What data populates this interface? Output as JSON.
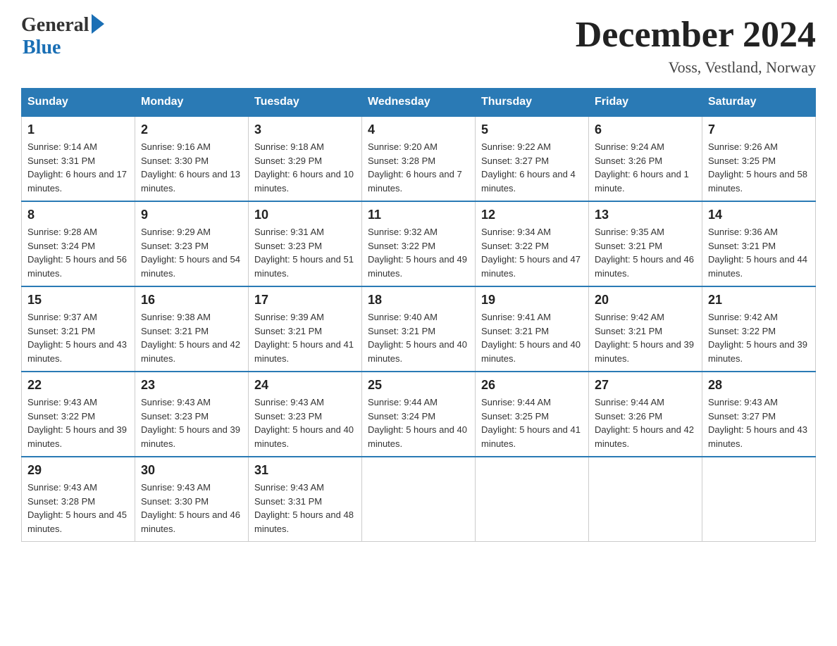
{
  "logo": {
    "general": "General",
    "blue": "Blue"
  },
  "header": {
    "title": "December 2024",
    "location": "Voss, Vestland, Norway"
  },
  "days_of_week": [
    "Sunday",
    "Monday",
    "Tuesday",
    "Wednesday",
    "Thursday",
    "Friday",
    "Saturday"
  ],
  "weeks": [
    [
      {
        "day": "1",
        "sunrise": "9:14 AM",
        "sunset": "3:31 PM",
        "daylight": "6 hours and 17 minutes."
      },
      {
        "day": "2",
        "sunrise": "9:16 AM",
        "sunset": "3:30 PM",
        "daylight": "6 hours and 13 minutes."
      },
      {
        "day": "3",
        "sunrise": "9:18 AM",
        "sunset": "3:29 PM",
        "daylight": "6 hours and 10 minutes."
      },
      {
        "day": "4",
        "sunrise": "9:20 AM",
        "sunset": "3:28 PM",
        "daylight": "6 hours and 7 minutes."
      },
      {
        "day": "5",
        "sunrise": "9:22 AM",
        "sunset": "3:27 PM",
        "daylight": "6 hours and 4 minutes."
      },
      {
        "day": "6",
        "sunrise": "9:24 AM",
        "sunset": "3:26 PM",
        "daylight": "6 hours and 1 minute."
      },
      {
        "day": "7",
        "sunrise": "9:26 AM",
        "sunset": "3:25 PM",
        "daylight": "5 hours and 58 minutes."
      }
    ],
    [
      {
        "day": "8",
        "sunrise": "9:28 AM",
        "sunset": "3:24 PM",
        "daylight": "5 hours and 56 minutes."
      },
      {
        "day": "9",
        "sunrise": "9:29 AM",
        "sunset": "3:23 PM",
        "daylight": "5 hours and 54 minutes."
      },
      {
        "day": "10",
        "sunrise": "9:31 AM",
        "sunset": "3:23 PM",
        "daylight": "5 hours and 51 minutes."
      },
      {
        "day": "11",
        "sunrise": "9:32 AM",
        "sunset": "3:22 PM",
        "daylight": "5 hours and 49 minutes."
      },
      {
        "day": "12",
        "sunrise": "9:34 AM",
        "sunset": "3:22 PM",
        "daylight": "5 hours and 47 minutes."
      },
      {
        "day": "13",
        "sunrise": "9:35 AM",
        "sunset": "3:21 PM",
        "daylight": "5 hours and 46 minutes."
      },
      {
        "day": "14",
        "sunrise": "9:36 AM",
        "sunset": "3:21 PM",
        "daylight": "5 hours and 44 minutes."
      }
    ],
    [
      {
        "day": "15",
        "sunrise": "9:37 AM",
        "sunset": "3:21 PM",
        "daylight": "5 hours and 43 minutes."
      },
      {
        "day": "16",
        "sunrise": "9:38 AM",
        "sunset": "3:21 PM",
        "daylight": "5 hours and 42 minutes."
      },
      {
        "day": "17",
        "sunrise": "9:39 AM",
        "sunset": "3:21 PM",
        "daylight": "5 hours and 41 minutes."
      },
      {
        "day": "18",
        "sunrise": "9:40 AM",
        "sunset": "3:21 PM",
        "daylight": "5 hours and 40 minutes."
      },
      {
        "day": "19",
        "sunrise": "9:41 AM",
        "sunset": "3:21 PM",
        "daylight": "5 hours and 40 minutes."
      },
      {
        "day": "20",
        "sunrise": "9:42 AM",
        "sunset": "3:21 PM",
        "daylight": "5 hours and 39 minutes."
      },
      {
        "day": "21",
        "sunrise": "9:42 AM",
        "sunset": "3:22 PM",
        "daylight": "5 hours and 39 minutes."
      }
    ],
    [
      {
        "day": "22",
        "sunrise": "9:43 AM",
        "sunset": "3:22 PM",
        "daylight": "5 hours and 39 minutes."
      },
      {
        "day": "23",
        "sunrise": "9:43 AM",
        "sunset": "3:23 PM",
        "daylight": "5 hours and 39 minutes."
      },
      {
        "day": "24",
        "sunrise": "9:43 AM",
        "sunset": "3:23 PM",
        "daylight": "5 hours and 40 minutes."
      },
      {
        "day": "25",
        "sunrise": "9:44 AM",
        "sunset": "3:24 PM",
        "daylight": "5 hours and 40 minutes."
      },
      {
        "day": "26",
        "sunrise": "9:44 AM",
        "sunset": "3:25 PM",
        "daylight": "5 hours and 41 minutes."
      },
      {
        "day": "27",
        "sunrise": "9:44 AM",
        "sunset": "3:26 PM",
        "daylight": "5 hours and 42 minutes."
      },
      {
        "day": "28",
        "sunrise": "9:43 AM",
        "sunset": "3:27 PM",
        "daylight": "5 hours and 43 minutes."
      }
    ],
    [
      {
        "day": "29",
        "sunrise": "9:43 AM",
        "sunset": "3:28 PM",
        "daylight": "5 hours and 45 minutes."
      },
      {
        "day": "30",
        "sunrise": "9:43 AM",
        "sunset": "3:30 PM",
        "daylight": "5 hours and 46 minutes."
      },
      {
        "day": "31",
        "sunrise": "9:43 AM",
        "sunset": "3:31 PM",
        "daylight": "5 hours and 48 minutes."
      },
      null,
      null,
      null,
      null
    ]
  ],
  "labels": {
    "sunrise_prefix": "Sunrise: ",
    "sunset_prefix": "Sunset: ",
    "daylight_prefix": "Daylight: "
  }
}
